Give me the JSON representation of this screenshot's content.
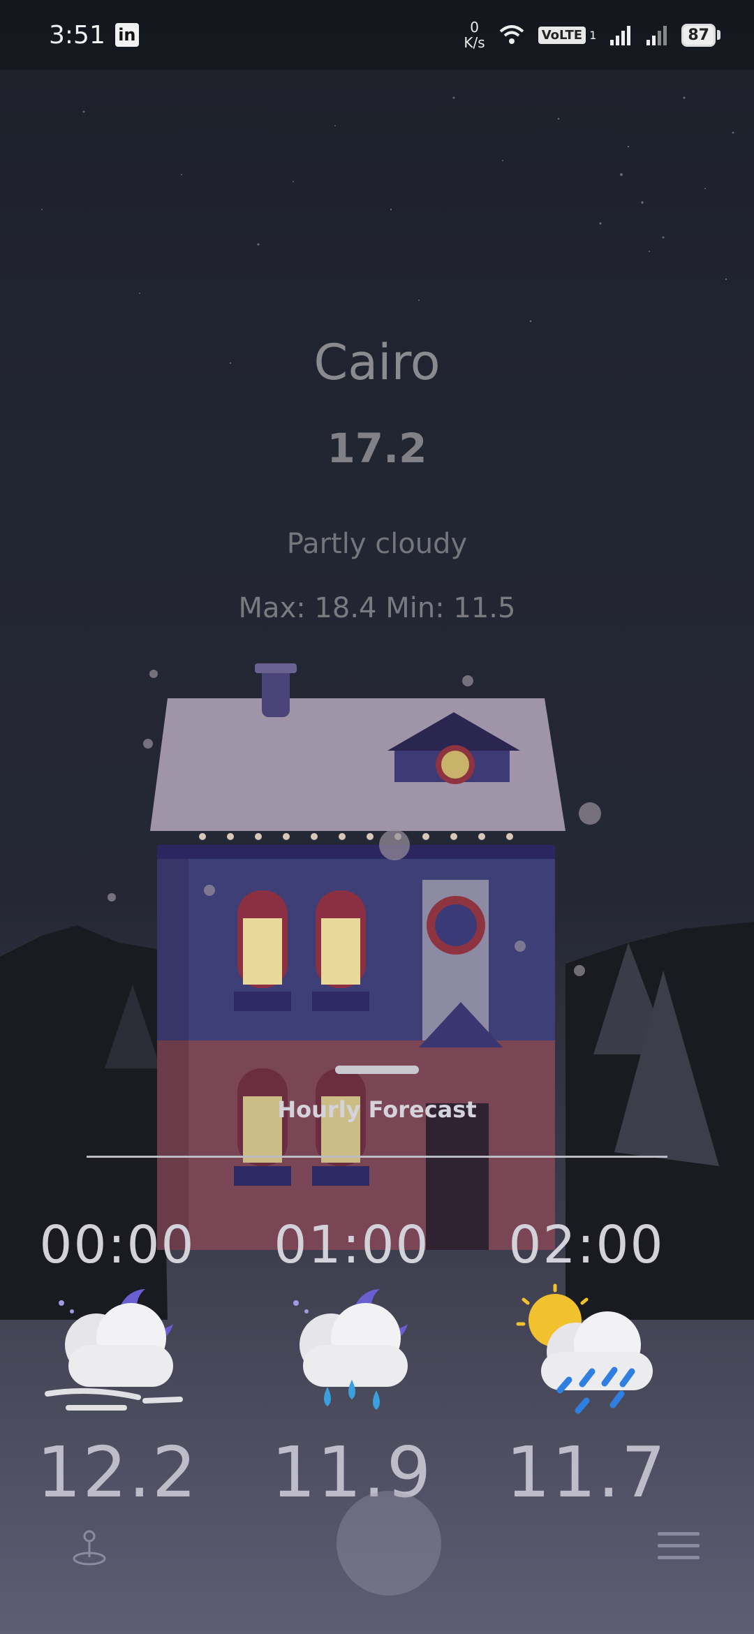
{
  "status_bar": {
    "time": "3:51",
    "app_badge": "in",
    "net_speed_value": "0",
    "net_speed_unit": "K/s",
    "volte": "VoLTE",
    "sim_index": "1",
    "battery": "87"
  },
  "weather": {
    "city": "Cairo",
    "temperature": "17.2",
    "condition": "Partly cloudy",
    "max_min": "Max: 18.4  Min: 11.5"
  },
  "forecast_sheet": {
    "title": "Hourly Forecast",
    "hours": [
      {
        "time": "00:00",
        "temp": "12.2",
        "icon": "night-cloud-wind-icon"
      },
      {
        "time": "01:00",
        "temp": "11.9",
        "icon": "night-cloud-rain-icon"
      },
      {
        "time": "02:00",
        "temp": "11.7",
        "icon": "sun-cloud-rain-icon"
      }
    ]
  },
  "nav": {
    "left_icon": "location-pin-icon",
    "center_icon": "home-button-icon",
    "right_icon": "menu-icon"
  },
  "colors": {
    "house_wall_blue": "#3f3f78",
    "house_wall_red": "#7a4655",
    "roof": "#9f94a8",
    "text_primary": "#8a8a8f"
  }
}
